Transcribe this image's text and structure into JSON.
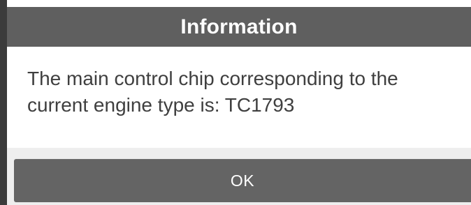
{
  "dialog": {
    "title": "Information",
    "message": "The main control chip corresponding to the current engine type is: TC1793",
    "ok_label": "OK"
  },
  "colors": {
    "title_bar": "#5f5f5f",
    "button": "#646464",
    "text": "#3f3f3f"
  }
}
